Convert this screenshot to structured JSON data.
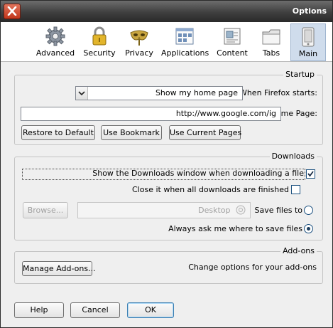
{
  "window": {
    "title": "Options"
  },
  "toolbar": {
    "panes": [
      {
        "id": "main",
        "label": "Main",
        "icon": "main-pane-icon",
        "active": true
      },
      {
        "id": "tabs",
        "label": "Tabs",
        "icon": "tabs-folder-icon"
      },
      {
        "id": "content",
        "label": "Content",
        "icon": "content-icon"
      },
      {
        "id": "applications",
        "label": "Applications",
        "icon": "applications-icon"
      },
      {
        "id": "privacy",
        "label": "Privacy",
        "icon": "privacy-mask-icon"
      },
      {
        "id": "security",
        "label": "Security",
        "icon": "lock-icon"
      },
      {
        "id": "advanced",
        "label": "Advanced",
        "icon": "gear-icon"
      }
    ]
  },
  "startup": {
    "legend": "Startup",
    "when_label": "When Firefox starts:",
    "when_value": "Show my home page",
    "home_label": "Home Page:",
    "home_value": "http://www.google.com/ig",
    "buttons": {
      "current": "Use Current Pages",
      "bookmark": "Use Bookmark",
      "restore": "Restore to Default"
    }
  },
  "downloads": {
    "legend": "Downloads",
    "show_window": {
      "label": "Show the Downloads window when downloading a file",
      "checked": true
    },
    "close_when_done": {
      "label": "Close it when all downloads are finished",
      "checked": false
    },
    "save_to": {
      "label": "Save files to",
      "folder": "Desktop",
      "browse": "Browse...",
      "selected": false
    },
    "always_ask": {
      "label": "Always ask me where to save files",
      "selected": true
    }
  },
  "addons": {
    "legend": "Add-ons",
    "text": "Change options for your add-ons",
    "manage": "Manage Add-ons..."
  },
  "footer": {
    "ok": "OK",
    "cancel": "Cancel",
    "help": "Help"
  },
  "colors": {
    "accent": "#3c7fb1",
    "close": "#c2361b",
    "active_pane": "#cfdcec"
  }
}
